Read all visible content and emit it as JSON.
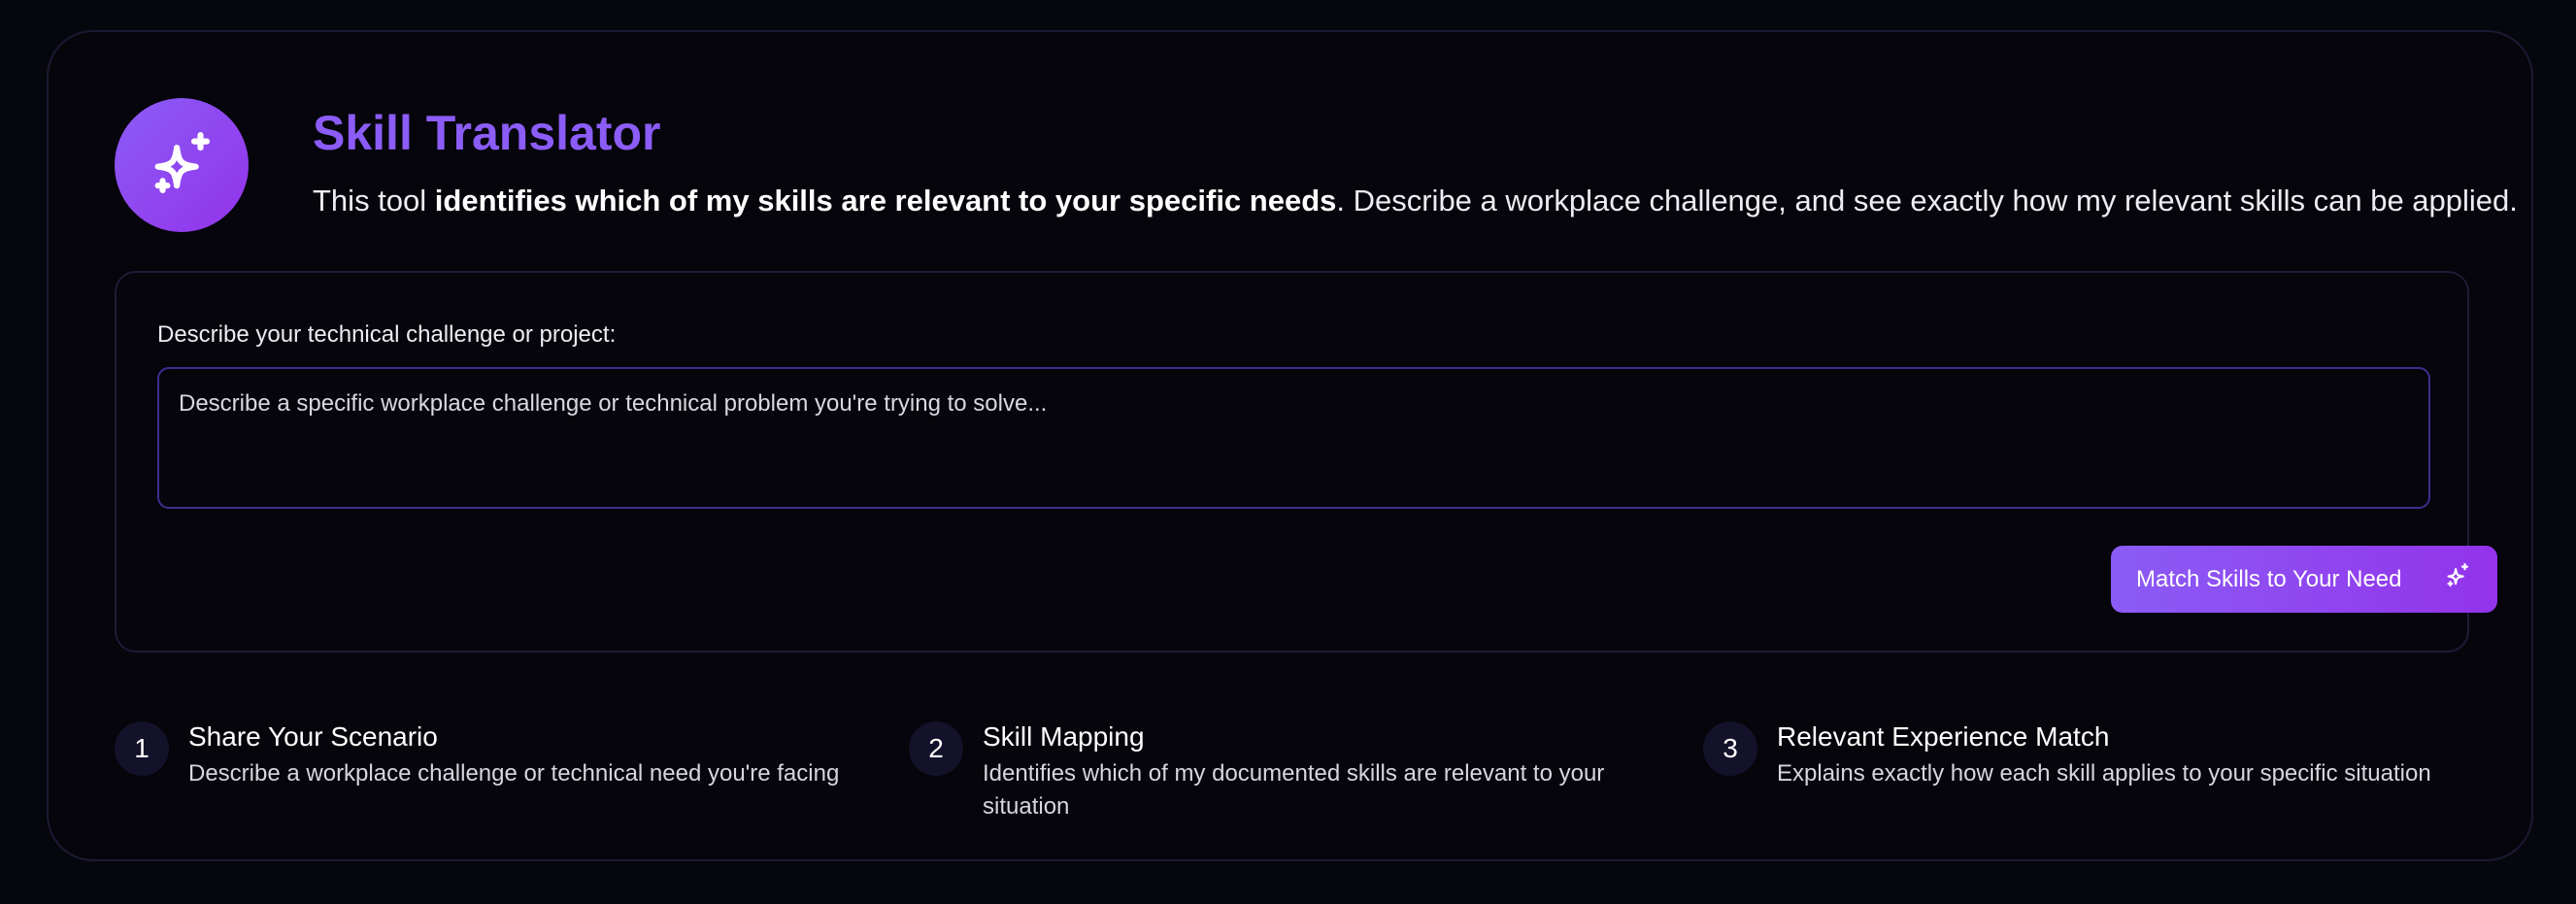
{
  "header": {
    "icon": "sparkles-icon",
    "title": "Skill Translator",
    "description_prefix": "This tool ",
    "description_bold": "identifies which of my skills are relevant to your specific needs",
    "description_suffix": ". Describe a workplace challenge, and see exactly how my relevant skills can be applied."
  },
  "form": {
    "label": "Describe your technical challenge or project:",
    "placeholder": "Describe a specific workplace challenge or technical problem you're trying to solve...",
    "value": "",
    "button_label": "Match Skills to Your Need",
    "button_icon": "sparkles-icon"
  },
  "steps": [
    {
      "number": "1",
      "title": "Share Your Scenario",
      "description": "Describe a workplace challenge or technical need you're facing"
    },
    {
      "number": "2",
      "title": "Skill Mapping",
      "description": "Identifies which of my documented skills are relevant to your situation"
    },
    {
      "number": "3",
      "title": "Relevant Experience Match",
      "description": "Explains exactly how each skill applies to your specific situation"
    }
  ],
  "colors": {
    "accent": "#8b5cf6",
    "accent_end": "#9333ea",
    "background": "#05050b",
    "border": "#1b1a33"
  }
}
